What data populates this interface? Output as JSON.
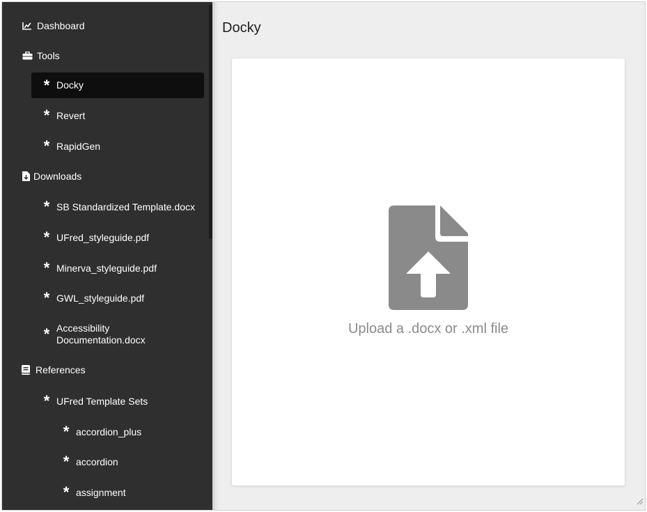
{
  "sidebar": {
    "items": [
      {
        "label": "Dashboard",
        "icon": "chart-line-icon",
        "level": 0
      },
      {
        "label": "Tools",
        "icon": "toolbox-icon",
        "level": 0
      },
      {
        "label": "Docky",
        "icon": "asterisk-icon",
        "level": 1,
        "active": true
      },
      {
        "label": "Revert",
        "icon": "asterisk-icon",
        "level": 1
      },
      {
        "label": "RapidGen",
        "icon": "asterisk-icon",
        "level": 1
      },
      {
        "label": "Downloads",
        "icon": "file-download-icon",
        "level": 0
      },
      {
        "label": "SB Standardized Template.docx",
        "icon": "asterisk-icon",
        "level": 1
      },
      {
        "label": "UFred_styleguide.pdf",
        "icon": "asterisk-icon",
        "level": 1
      },
      {
        "label": "Minerva_styleguide.pdf",
        "icon": "asterisk-icon",
        "level": 1
      },
      {
        "label": "GWL_styleguide.pdf",
        "icon": "asterisk-icon",
        "level": 1
      },
      {
        "label": "Accessibility Documentation.docx",
        "icon": "asterisk-icon",
        "level": 1
      },
      {
        "label": "References",
        "icon": "book-icon",
        "level": 0
      },
      {
        "label": "UFred Template Sets",
        "icon": "asterisk-icon",
        "level": 1
      },
      {
        "label": "accordion_plus",
        "icon": "asterisk-icon",
        "level": 2
      },
      {
        "label": "accordion",
        "icon": "asterisk-icon",
        "level": 2
      },
      {
        "label": "assignment",
        "icon": "asterisk-icon",
        "level": 2
      }
    ]
  },
  "main": {
    "title": "Docky",
    "upload": {
      "text": "Upload a .docx or .xml file",
      "icon": "file-upload-icon"
    }
  },
  "colors": {
    "sidebar_bg": "#2f2f2f",
    "active_bg": "#0e0e0e",
    "main_bg": "#eeeeee",
    "icon_gray": "#8a8a8a"
  }
}
